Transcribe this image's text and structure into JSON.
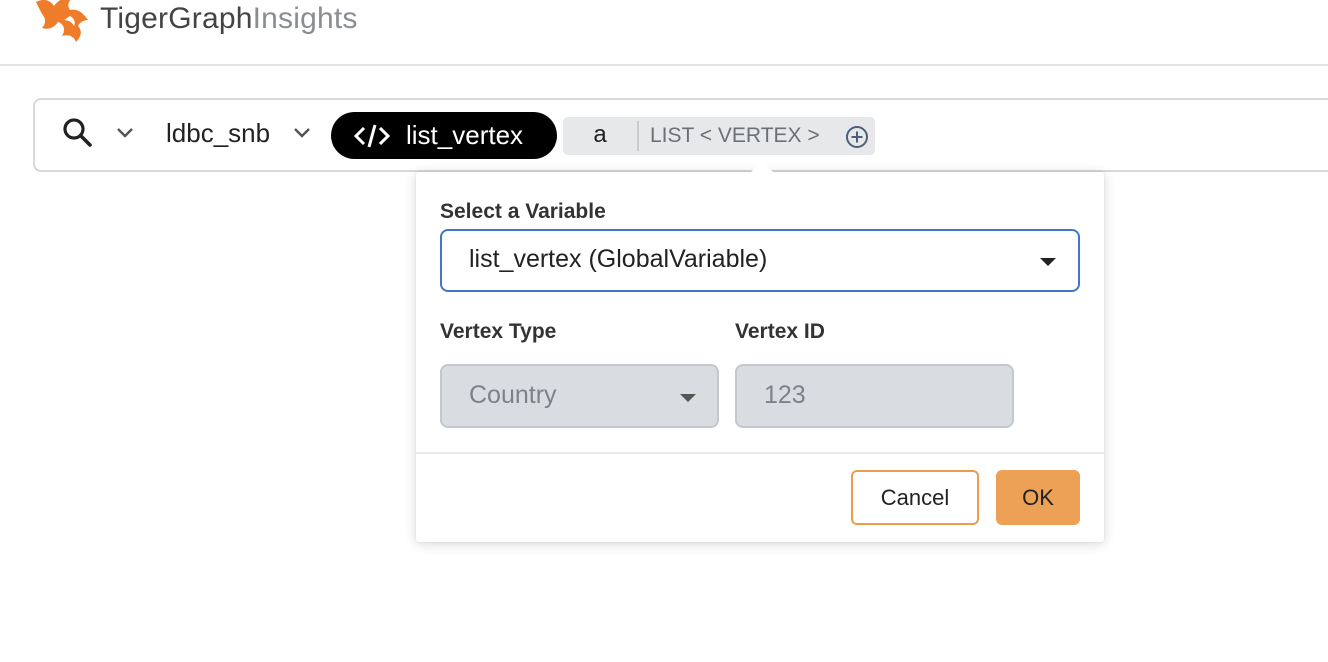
{
  "header": {
    "brand_primary": "TigerGraph",
    "brand_secondary": "Insights",
    "logo_icon": "tiger-logo-icon",
    "brand_color": "#EE7C2B"
  },
  "searchbar": {
    "search_icon": "search-icon",
    "graph_name": "ldbc_snb",
    "query_name": "list_vertex",
    "param": {
      "name": "a",
      "type": "LIST < VERTEX >",
      "add_icon": "plus-circle-icon"
    }
  },
  "popover": {
    "select_variable_label": "Select a Variable",
    "selected_variable": "list_vertex (GlobalVariable)",
    "vertex_type_label": "Vertex Type",
    "vertex_type_value": "Country",
    "vertex_id_label": "Vertex ID",
    "vertex_id_value": "123",
    "cancel_label": "Cancel",
    "ok_label": "OK",
    "accent_color": "#EDA156",
    "focus_color": "#3F77C9"
  }
}
